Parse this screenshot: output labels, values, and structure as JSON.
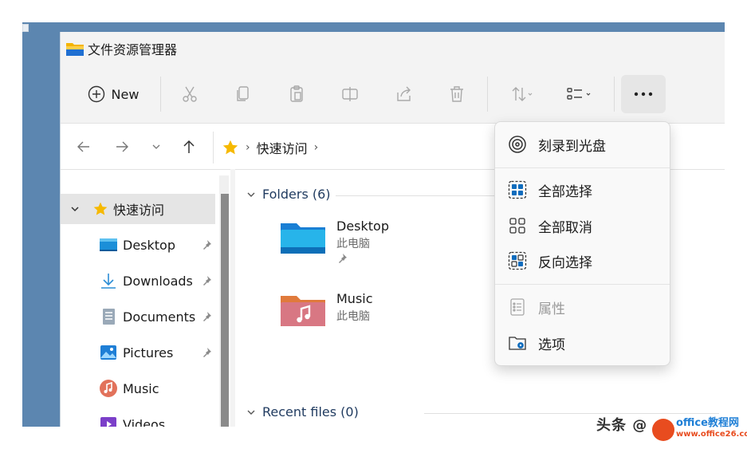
{
  "window": {
    "title": "文件资源管理器"
  },
  "toolbar": {
    "new_label": "New"
  },
  "address": {
    "crumb": "快速访问"
  },
  "sidebar": {
    "items": [
      {
        "label": "快速访问",
        "icon": "star-icon",
        "active": true
      },
      {
        "label": "Desktop",
        "icon": "desktop-icon",
        "pinned": true
      },
      {
        "label": "Downloads",
        "icon": "download-icon",
        "pinned": true
      },
      {
        "label": "Documents",
        "icon": "documents-icon",
        "pinned": true
      },
      {
        "label": "Pictures",
        "icon": "pictures-icon",
        "pinned": true
      },
      {
        "label": "Music",
        "icon": "music-icon"
      },
      {
        "label": "Videos",
        "icon": "videos-icon"
      }
    ]
  },
  "content": {
    "folders_header": "Folders (6)",
    "recent_header": "Recent files (0)",
    "folders": [
      {
        "name": "Desktop",
        "location": "此电脑",
        "pinned": true
      },
      {
        "name": "Music",
        "location": "此电脑"
      }
    ]
  },
  "menu": {
    "items": [
      {
        "label": "刻录到光盘",
        "icon": "disc-icon"
      },
      {
        "label": "全部选择",
        "icon": "select-all-icon"
      },
      {
        "label": "全部取消",
        "icon": "select-none-icon"
      },
      {
        "label": "反向选择",
        "icon": "invert-selection-icon"
      },
      {
        "label": "属性",
        "icon": "properties-icon",
        "disabled": true
      },
      {
        "label": "选项",
        "icon": "options-icon"
      }
    ]
  },
  "watermark": {
    "text": "头条 @",
    "site": "office教程网",
    "url_text": "www.office26.com"
  },
  "colors": {
    "accent": "#0f6cbd",
    "menu_bg": "#f9f9f9",
    "selected": "#e5e5e5"
  }
}
